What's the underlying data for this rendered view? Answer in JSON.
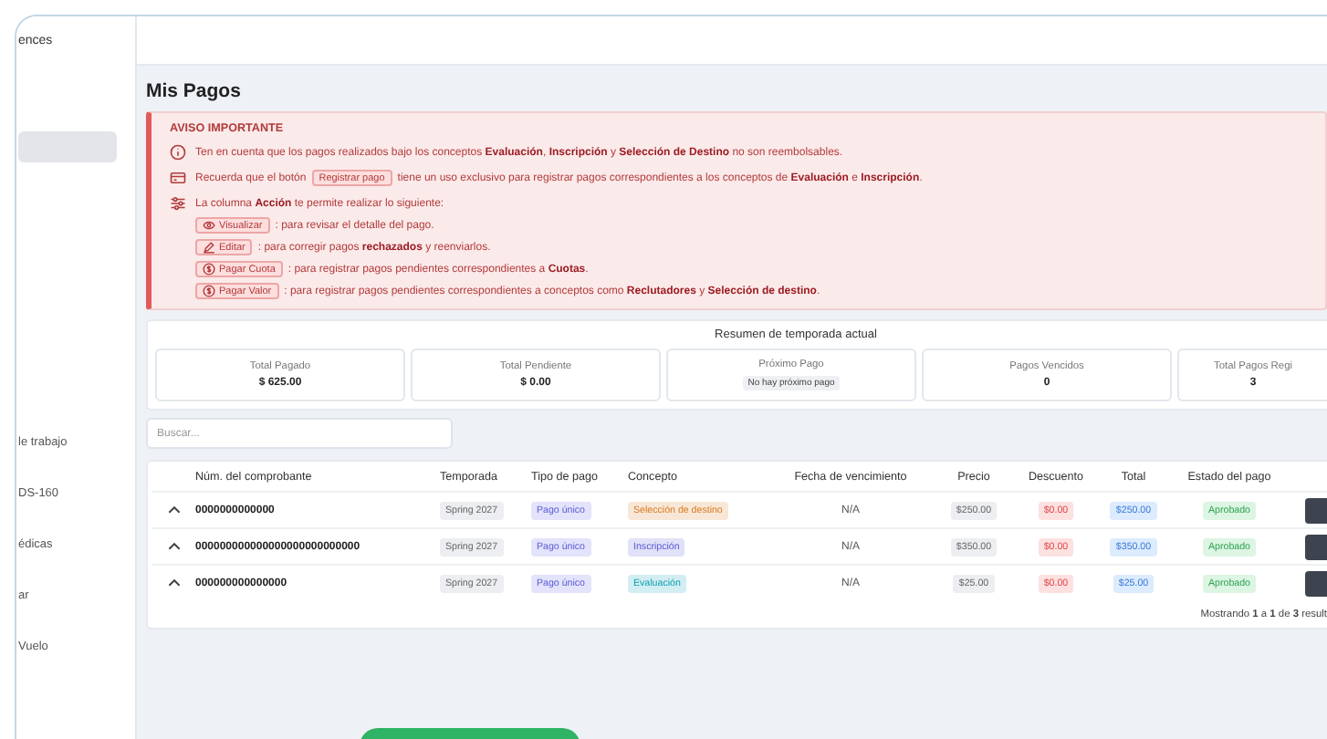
{
  "sidebar": {
    "heading": "ences",
    "items": [
      {
        "label": "le trabajo"
      },
      {
        "label": "DS-160"
      },
      {
        "label": "édicas"
      },
      {
        "label": "ar"
      },
      {
        "label": "Vuelo"
      }
    ]
  },
  "page_title": "Mis Pagos",
  "notice": {
    "title": "AVISO IMPORTANTE",
    "notes": [
      {
        "kind": "info",
        "text": "Ten en cuenta que los pagos realizados bajo los conceptos **Evaluación**, **Inscripción** y **Selección de Destino** no son reembolsables."
      },
      {
        "kind": "button",
        "before": "Recuerda que el botón",
        "button": "Registrar pago",
        "after": "tiene un uso exclusivo para registrar pagos correspondientes a los conceptos de **Evaluación** e **Inscripción**."
      },
      {
        "kind": "actions",
        "text": "La columna **Acción** te permite realizar lo siguiente:",
        "actions": [
          {
            "kind": "view",
            "label": "Visualizar",
            "text": ": para revisar el detalle del pago."
          },
          {
            "kind": "edit",
            "label": "Editar",
            "text": ": para corregir pagos **rechazados** y reenviarlos."
          },
          {
            "kind": "pay",
            "label": "Pagar Cuota",
            "text": ": para registrar pagos pendientes correspondientes a **Cuotas**."
          },
          {
            "kind": "pay",
            "label": "Pagar Valor",
            "text": ": para registrar pagos pendientes correspondientes a conceptos como **Reclutadores** y **Selección de destino**."
          }
        ]
      }
    ]
  },
  "summary": {
    "title": "Resumen de temporada actual",
    "cards": [
      {
        "label": "Total Pagado",
        "value": "$ 625.00",
        "kind": "amount"
      },
      {
        "label": "Total Pendiente",
        "value": "$ 0.00",
        "kind": "amount"
      },
      {
        "label": "Próximo Pago",
        "value": "No hay próximo pago",
        "kind": "badge"
      },
      {
        "label": "Pagos Vencidos",
        "value": "0",
        "kind": "amount"
      },
      {
        "label": "Total Pagos Regi",
        "value": "3",
        "kind": "amount"
      }
    ]
  },
  "search": {
    "placeholder": "Buscar..."
  },
  "table": {
    "columns": [
      "Núm. del comprobante",
      "Temporada",
      "Tipo de pago",
      "Concepto",
      "Fecha de vencimiento",
      "Precio",
      "Descuento",
      "Total",
      "Estado del pago"
    ],
    "rows": [
      {
        "voucher": "0000000000000",
        "season": "Spring 2027",
        "payment_type": "Pago único",
        "concept": {
          "label": "Selección de destino",
          "color": "#d97a1e"
        },
        "due_date": "N/A",
        "price": "$250.00",
        "discount": "$0.00",
        "total": "$250.00",
        "status": "Aprobado"
      },
      {
        "voucher": "000000000000000000000000000",
        "season": "Spring 2027",
        "payment_type": "Pago único",
        "concept": {
          "label": "Inscripción",
          "color": "#5b5bd6"
        },
        "due_date": "N/A",
        "price": "$350.00",
        "discount": "$0.00",
        "total": "$350.00",
        "status": "Aprobado"
      },
      {
        "voucher": "000000000000000",
        "season": "Spring 2027",
        "payment_type": "Pago único",
        "concept": {
          "label": "Evaluación",
          "color": "#0d9fb5"
        },
        "due_date": "N/A",
        "price": "$25.00",
        "discount": "$0.00",
        "total": "$25.00",
        "status": "Aprobado"
      }
    ],
    "footer": "Mostrando **1** a **1** de **3** result"
  }
}
